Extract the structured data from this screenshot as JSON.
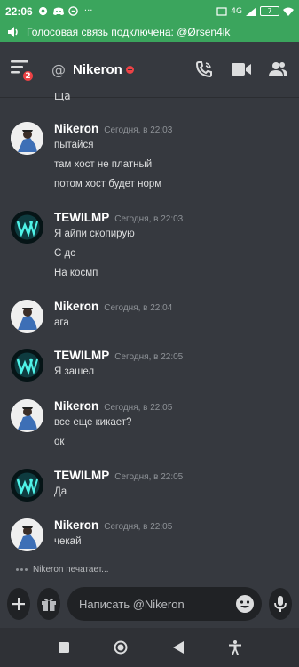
{
  "statusbar": {
    "time": "22:06",
    "network": "4G",
    "battery": "7"
  },
  "voice": {
    "text": "Голосовая связь подключена: @Ørsen4ik"
  },
  "header": {
    "at": "@",
    "name": "Nikeron",
    "badge": "2"
  },
  "messages": {
    "tail": "ща",
    "groups": [
      {
        "author": "Nikeron",
        "time": "Сегодня, в 22:03",
        "lines": [
          "пытайся",
          "там хост не платный",
          "потом хост будет норм"
        ]
      },
      {
        "author": "TEWILMP",
        "time": "Сегодня, в 22:03",
        "lines": [
          "Я айпи скопирую",
          "С дс",
          "На космп"
        ]
      },
      {
        "author": "Nikeron",
        "time": "Сегодня, в 22:04",
        "lines": [
          "ага"
        ]
      },
      {
        "author": "TEWILMP",
        "time": "Сегодня, в 22:05",
        "lines": [
          "Я зашел"
        ]
      },
      {
        "author": "Nikeron",
        "time": "Сегодня, в 22:05",
        "lines": [
          "все еще кикает?",
          "ок"
        ]
      },
      {
        "author": "TEWILMP",
        "time": "Сегодня, в 22:05",
        "lines": [
          "Да"
        ]
      },
      {
        "author": "Nikeron",
        "time": "Сегодня, в 22:05",
        "lines": [
          "чекай"
        ]
      }
    ]
  },
  "typing": {
    "text": "Nikeron печатает..."
  },
  "composer": {
    "placeholder": "Написать @Nikeron"
  },
  "colors": {
    "accent": "#3ba55d",
    "background": "#36393f",
    "dnd": "#ed4245"
  },
  "icons": [
    "discord-icon",
    "speaker-icon",
    "hamburger-menu-icon",
    "phone-call-icon",
    "video-camera-icon",
    "members-icon",
    "plus-icon",
    "gift-icon",
    "emoji-icon",
    "microphone-icon",
    "square-nav-icon",
    "circle-nav-icon",
    "back-triangle-icon",
    "accessibility-icon"
  ]
}
